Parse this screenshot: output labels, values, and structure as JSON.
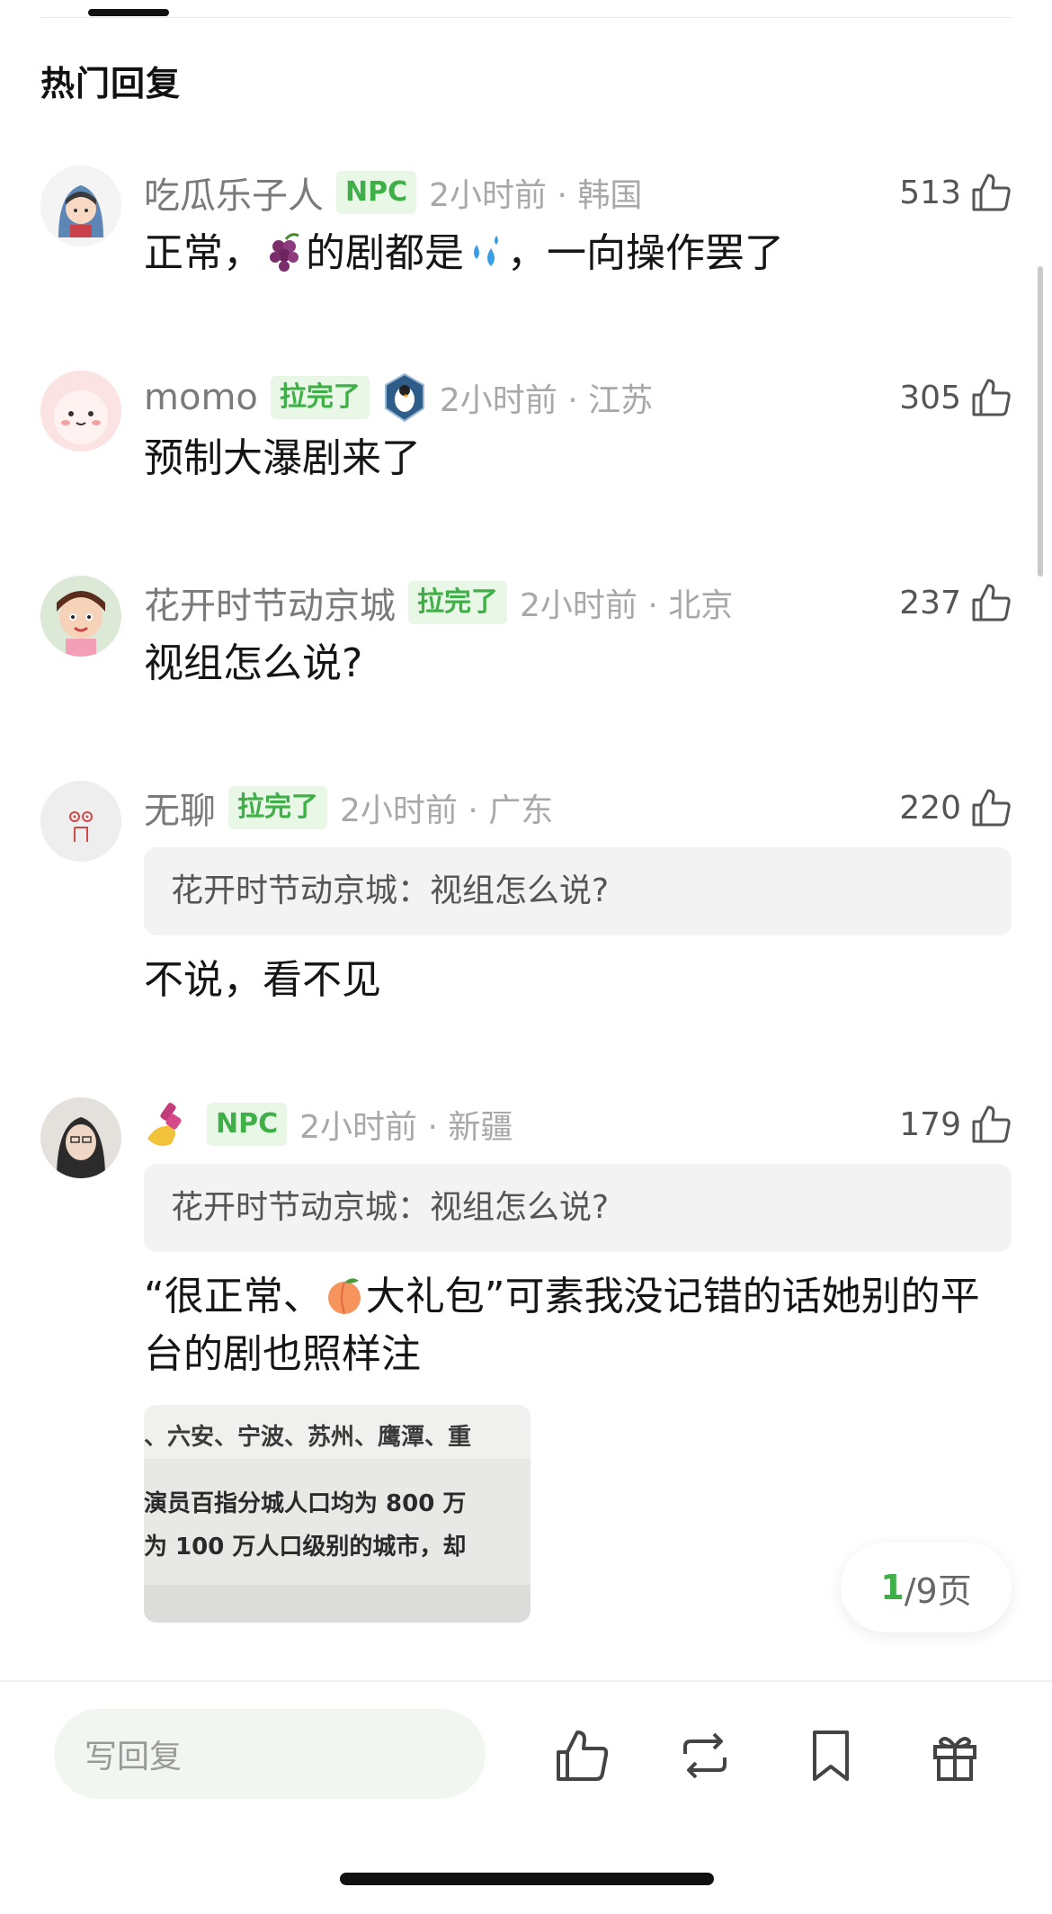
{
  "section_title": "热门回复",
  "comments": [
    {
      "username": "吃瓜乐子人",
      "badge": "NPC",
      "time": "2小时前 · 韩国",
      "likes": "513",
      "text_before": "正常，",
      "text_mid": "的剧都是",
      "text_after": "，一向操作罢了",
      "emoji1": "grapes-emoji",
      "emoji2": "sweat-droplets-emoji"
    },
    {
      "username": "momo",
      "badge": "拉完了",
      "time": "2小时前 · 江苏",
      "likes": "305",
      "text": "预制大瀑剧来了"
    },
    {
      "username": "花开时节动京城",
      "badge": "拉完了",
      "time": "2小时前 · 北京",
      "likes": "237",
      "text": "视组怎么说?"
    },
    {
      "username": "无聊",
      "badge": "拉完了",
      "time": "2小时前 · 广东",
      "likes": "220",
      "quote": "花开时节动京城：视组怎么说?",
      "text": "不说，看不见"
    },
    {
      "username_emoji": "nail-polish-emoji",
      "badge": "NPC",
      "time": "2小时前 · 新疆",
      "likes": "179",
      "quote": "花开时节动京城：视组怎么说?",
      "text_before": "“很正常、",
      "text_after": "大礼包”可素我没记错的话她别的平台的剧也照样注",
      "emoji": "peach-emoji",
      "image_lines": [
        "、六安、宁波、苏州、鹰潭、重",
        "演员百指分城人口均为 800 万",
        "为 100 万人口级别的城市，却"
      ]
    }
  ],
  "pager": {
    "current": "1",
    "total": "/9页"
  },
  "bottom_bar": {
    "reply_placeholder": "写回复"
  }
}
